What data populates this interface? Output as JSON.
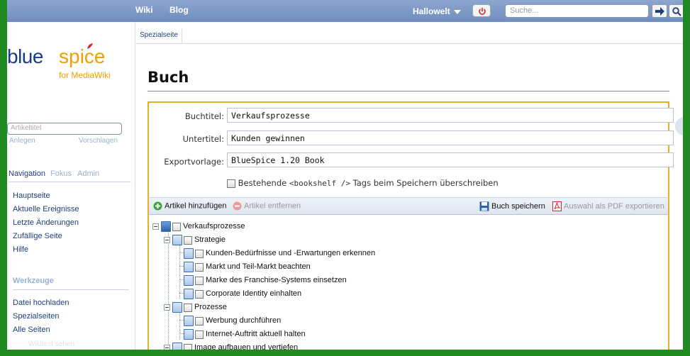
{
  "topbar": {
    "links": [
      "Wiki",
      "Blog"
    ],
    "user": "Hallowelt",
    "search_placeholder": "Suche..."
  },
  "logo": {
    "word1": "blue",
    "word2": "spice",
    "tagline": "for MediaWiki"
  },
  "sidebar": {
    "article_placeholder": "Artikeltitel",
    "create": "Anlegen",
    "suggest": "Vorschlagen",
    "tabs": [
      "Navigation",
      "Fokus",
      "Admin"
    ],
    "nav": [
      "Hauptseite",
      "Aktuelle Ereignisse",
      "Letzte Änderungen",
      "Zufällige Seite",
      "Hilfe"
    ],
    "tools_title": "Werkzeuge",
    "tools": [
      "Datei hochladen",
      "Spezialseiten",
      "Alle Seiten"
    ],
    "faded": "Wikitext sehen"
  },
  "content": {
    "tab": "Spezialseite",
    "title": "Buch"
  },
  "form": {
    "title_label": "Buchtitel:",
    "title_value": "Verkaufsprozesse",
    "subtitle_label": "Untertitel:",
    "subtitle_value": "Kunden gewinnen",
    "template_label": "Exportvorlage:",
    "template_value": "BlueSpice 1.20 Book",
    "overwrite_pre": "Bestehende ",
    "overwrite_code": "<bookshelf />",
    "overwrite_post": " Tags beim Speichern überschreiben"
  },
  "toolbar": {
    "add": "Artikel hinzufügen",
    "remove": "Artikel entfernen",
    "save": "Buch speichern",
    "export": "Auswahl als PDF exportieren"
  },
  "tree": {
    "root": "Verkaufsprozesse",
    "n1": "Strategie",
    "n1a": "Kunden-Bedürfnisse und -Erwartungen erkennen",
    "n1b": "Markt und Teil-Markt beachten",
    "n1c": "Marke des Franchise-Systems einsetzen",
    "n1d": "Corporate Identity einhalten",
    "n2": "Prozesse",
    "n2a": "Werbung durchführen",
    "n2b": "Internet-Auftritt aktuell halten",
    "n3": "Image aufbauen und vertiefen"
  }
}
